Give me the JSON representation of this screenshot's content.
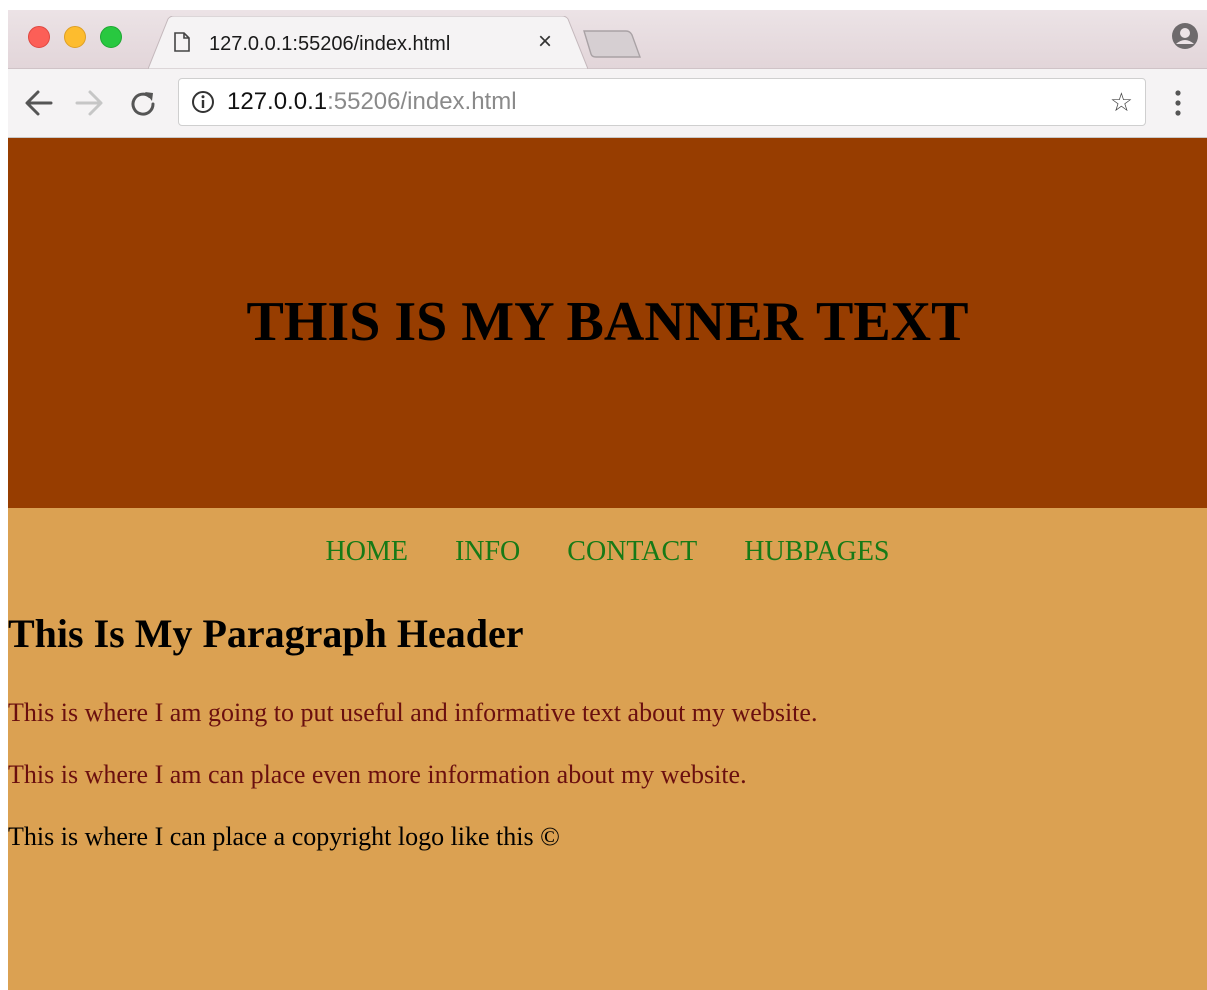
{
  "browser": {
    "tab": {
      "title": "127.0.0.1:55206/index.html",
      "close_label": "×"
    },
    "address_bar": {
      "host": "127.0.0.1",
      "rest": ":55206/index.html"
    },
    "icons": [
      "back-icon",
      "forward-icon",
      "reload-icon",
      "info-icon",
      "star-icon",
      "menu-icon",
      "profile-icon",
      "document-icon"
    ],
    "bookmark_glyph": "☆"
  },
  "page": {
    "banner_text": "THIS IS MY BANNER TEXT",
    "nav": [
      "HOME",
      "INFO",
      "CONTACT",
      "HUBPAGES"
    ],
    "header": "This Is My Paragraph Header",
    "paragraphs": [
      "This is where I am going to put useful and informative text about my website.",
      "This is where I am can place even more information about my website.",
      "This is where I can place a copyright logo like this ©"
    ]
  },
  "colors": {
    "banner_bg": "#973d00",
    "page_bg": "#dba152",
    "nav_link": "#177a17",
    "paragraph_text": "#6a0f0f"
  }
}
